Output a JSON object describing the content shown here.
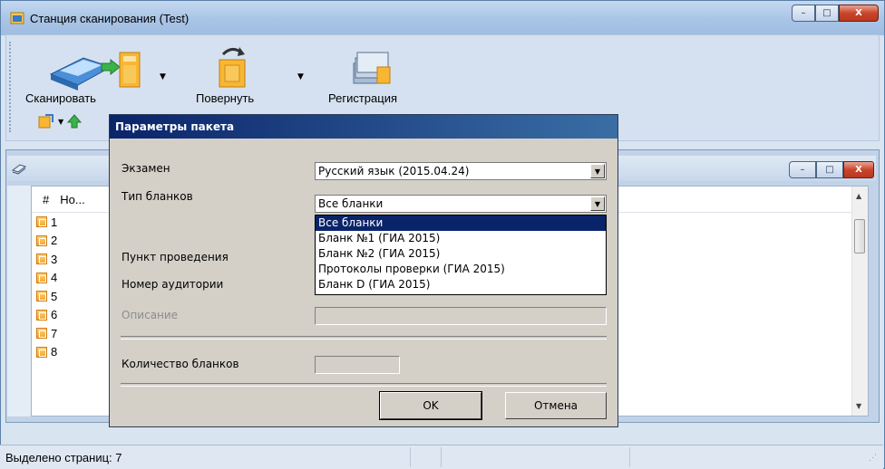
{
  "window": {
    "title": "Станция сканирования (Test)",
    "controls": {
      "minimize": "–",
      "maximize": "□",
      "close": "X"
    }
  },
  "toolbar": {
    "scan_label": "Сканировать",
    "rotate_label": "Повернуть",
    "register_label": "Регистрация"
  },
  "list": {
    "columns": [
      "#",
      "Но..."
    ],
    "rows": [
      "1",
      "2",
      "3",
      "4",
      "5",
      "6",
      "7",
      "8"
    ]
  },
  "status": {
    "selected_pages": "Выделено страниц: 7"
  },
  "dialog": {
    "title": "Параметры пакета",
    "exam_label": "Экзамен",
    "exam_value": "Русский язык (2015.04.24)",
    "form_type_label": "Тип бланков",
    "form_type_value": "Все бланки",
    "form_type_options": [
      "Все бланки",
      "Бланк №1 (ГИА 2015)",
      "Бланк №2 (ГИА 2015)",
      "Протоколы проверки (ГИА 2015)",
      "Бланк D (ГИА 2015)"
    ],
    "point_label": "Пункт проведения",
    "room_label": "Номер аудитории",
    "description_label": "Описание",
    "count_label": "Количество бланков",
    "ok_label": "OK",
    "cancel_label": "Отмена"
  },
  "colors": {
    "dialog_title_start": "#0a246a",
    "dialog_title_end": "#3a6ea5",
    "selection": "#0a246a",
    "close_button": "#c9442a"
  }
}
